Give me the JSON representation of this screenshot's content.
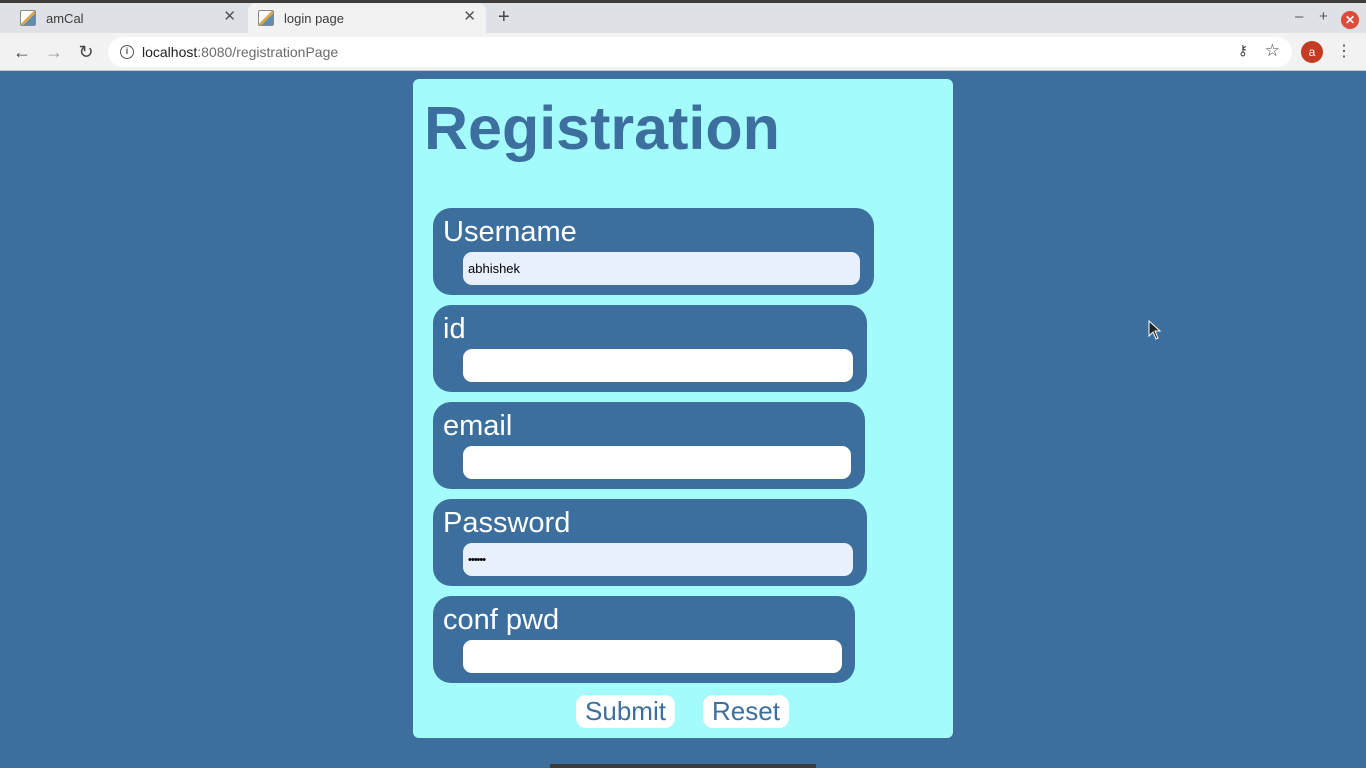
{
  "browser": {
    "tabs": [
      {
        "label": "amCal"
      },
      {
        "label": "login page"
      }
    ],
    "url_host": "localhost",
    "url_rest": ":8080/registrationPage",
    "profile_initial": "a"
  },
  "page": {
    "title": "Registration",
    "fields": [
      {
        "label": "Username",
        "value": "abhishek",
        "type": "text"
      },
      {
        "label": "id",
        "value": "",
        "type": "text"
      },
      {
        "label": "email",
        "value": "",
        "type": "text"
      },
      {
        "label": "Password",
        "value": "••••••",
        "type": "password"
      },
      {
        "label": "conf pwd",
        "value": "",
        "type": "password"
      }
    ],
    "buttons": {
      "submit": "Submit",
      "reset": "Reset"
    }
  },
  "colors": {
    "background": "#3d6f9e",
    "card": "#a4fbfc",
    "field_bg": "#3d6f9e",
    "autofill": "#e8f0fe"
  }
}
